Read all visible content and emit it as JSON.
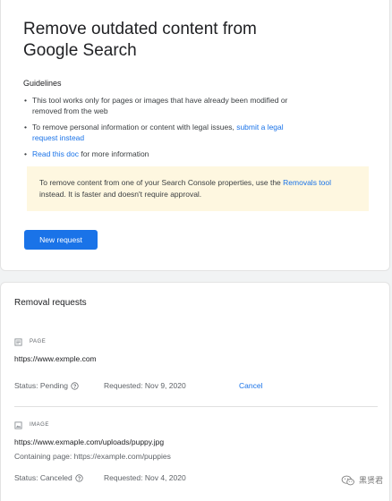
{
  "header": {
    "title": "Remove outdated content from Google Search"
  },
  "guidelines": {
    "heading": "Guidelines",
    "items": [
      {
        "text": "This tool works only for pages or images that have already been modified or removed from the web"
      },
      {
        "text_before": "To remove personal information or content with legal issues, ",
        "link": "submit a legal request instead"
      },
      {
        "link": "Read this doc",
        "text_after": " for more information"
      }
    ]
  },
  "notice": {
    "text_before": "To remove content from one of your Search Console properties, use the ",
    "link": "Removals tool",
    "text_after": " instead. It is faster and doesn't require approval."
  },
  "actions": {
    "new_request_label": "New request"
  },
  "removal_requests": {
    "heading": "Removal requests",
    "items": [
      {
        "type": "PAGE",
        "url": "https://www.exmple.com",
        "status": "Status: Pending",
        "requested": "Requested: Nov 9, 2020",
        "action": "Cancel"
      },
      {
        "type": "IMAGE",
        "url": "https://www.exmaple.com/uploads/puppy.jpg",
        "containing": "Containing page: https://example.com/puppies",
        "status": "Status: Canceled",
        "requested": "Requested: Nov 4, 2020"
      }
    ]
  },
  "watermark": {
    "text": "黑贤君"
  },
  "icons": {
    "bullet": "•",
    "page": "page-icon",
    "image": "image-icon",
    "help": "help-circle-icon",
    "wechat": "wechat-icon"
  },
  "colors": {
    "accent": "#1a73e8",
    "notice_background": "#fef7e0",
    "page_background": "#f1f3f4"
  }
}
